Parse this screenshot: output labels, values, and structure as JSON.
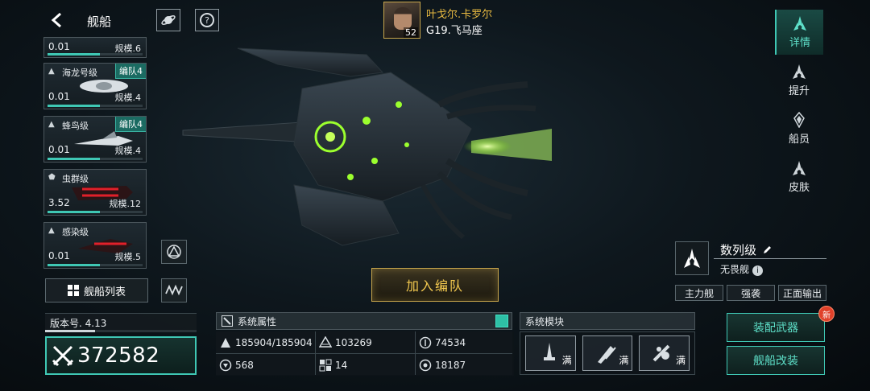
{
  "header": {
    "title": "舰船",
    "commander_name": "叶戈尔.卡罗尔",
    "commander_level": "52",
    "location": "G19.飞马座"
  },
  "fleet": [
    {
      "name": "",
      "badge": "",
      "value": "0.01",
      "scale": "规模.6",
      "progress": 0.55
    },
    {
      "name": "海龙号级",
      "badge": "编队4",
      "value": "0.01",
      "scale": "规模.4",
      "progress": 0.55
    },
    {
      "name": "蜂鸟级",
      "badge": "编队4",
      "value": "0.01",
      "scale": "规模.4",
      "progress": 0.55
    },
    {
      "name": "虫群级",
      "badge": "",
      "value": "3.52",
      "scale": "规模.12",
      "progress": 0.55
    },
    {
      "name": "感染级",
      "badge": "",
      "value": "0.01",
      "scale": "规模.5",
      "progress": 0.55
    }
  ],
  "ship_list_label": "舰船列表",
  "version": "版本号. 4.13",
  "power": "372582",
  "join_label": "加入编队",
  "attributes": {
    "title": "系统属性",
    "items": [
      {
        "icon": "hp-icon",
        "value": "185904/185904"
      },
      {
        "icon": "armor-icon",
        "value": "103269"
      },
      {
        "icon": "shield-icon",
        "value": "74534"
      },
      {
        "icon": "speed-icon",
        "value": "568"
      },
      {
        "icon": "evasion-icon",
        "value": "14"
      },
      {
        "icon": "target-icon",
        "value": "18187"
      }
    ]
  },
  "modules": {
    "title": "系统模块",
    "items": [
      {
        "icon": "cannon-icon",
        "status": "满"
      },
      {
        "icon": "missile-icon",
        "status": "满"
      },
      {
        "icon": "drone-icon",
        "status": "满"
      }
    ]
  },
  "ship_class": {
    "name": "数列级",
    "type": "无畏舰",
    "tags": [
      "主力舰",
      "强袭",
      "正面输出"
    ]
  },
  "actions": {
    "equip": "装配武器",
    "modify": "舰船改装",
    "new_badge": "新"
  },
  "right_nav": [
    "详情",
    "提升",
    "船员",
    "皮肤"
  ],
  "colors": {
    "accent": "#3fc7b4",
    "gold": "#e7b941"
  }
}
